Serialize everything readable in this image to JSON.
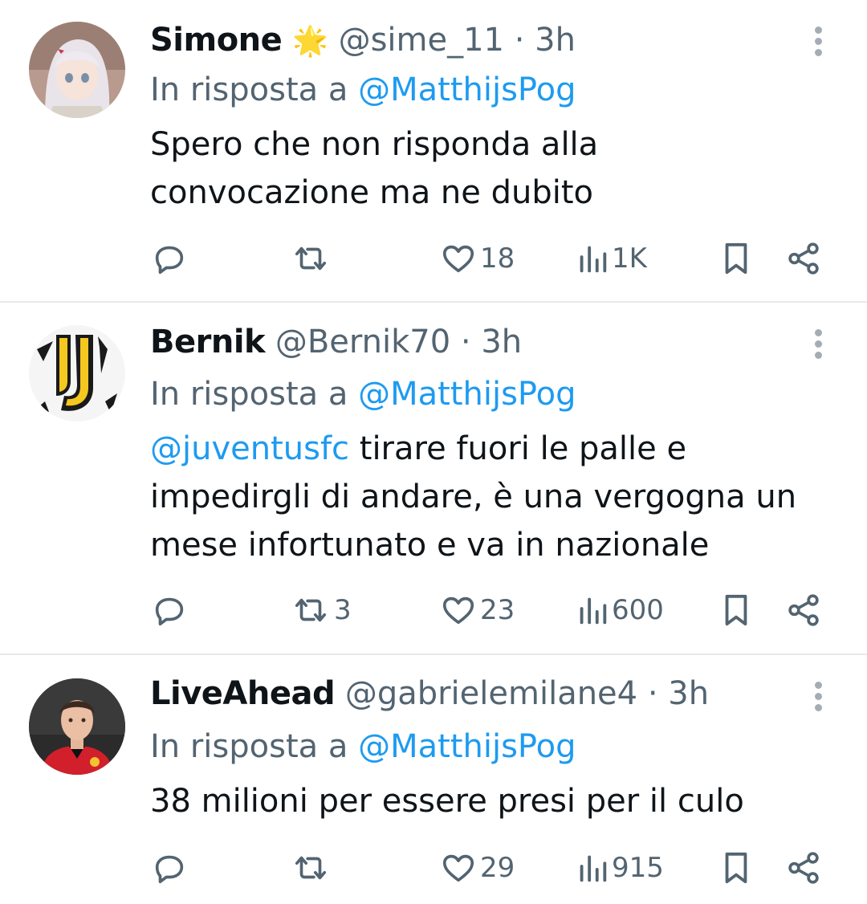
{
  "tweets": [
    {
      "name": "Simone",
      "badge": "🌟",
      "handle": "@sime_11",
      "separator": "·",
      "time": "3h",
      "reply_prefix": "In risposta a",
      "reply_to": "@MatthijsPog",
      "text": "Spero che non risponda alla convocazione ma ne dubito",
      "mention": "",
      "actions": {
        "replies": "",
        "retweets": "",
        "likes": "18",
        "views": "1K"
      }
    },
    {
      "name": "Bernik",
      "handle": "@Bernik70",
      "separator": "·",
      "time": "3h",
      "reply_prefix": "In risposta a",
      "reply_to": "@MatthijsPog",
      "mention": "@juventusfc",
      "text": " tirare fuori le palle e impedirgli di andare, è una vergogna un mese infortunato e va in nazionale",
      "actions": {
        "replies": "",
        "retweets": "3",
        "likes": "23",
        "views": "600"
      }
    },
    {
      "name": "LiveAhead",
      "handle": "@gabrielemilane4",
      "separator": "·",
      "time": "3h",
      "reply_prefix": "In risposta a",
      "reply_to": "@MatthijsPog",
      "mention": "",
      "text": "38 milioni per essere presi per il culo",
      "actions": {
        "replies": "",
        "retweets": "",
        "likes": "29",
        "views": "915"
      }
    }
  ],
  "icons": {
    "reply": "reply-icon",
    "retweet": "retweet-icon",
    "like": "heart-icon",
    "views": "views-icon",
    "bookmark": "bookmark-icon",
    "share": "share-icon",
    "more": "more-options-icon"
  },
  "colors": {
    "accent": "#1d9bf0",
    "text": "#0f1419",
    "secondary": "#536471",
    "divider": "#e7e9ec"
  }
}
